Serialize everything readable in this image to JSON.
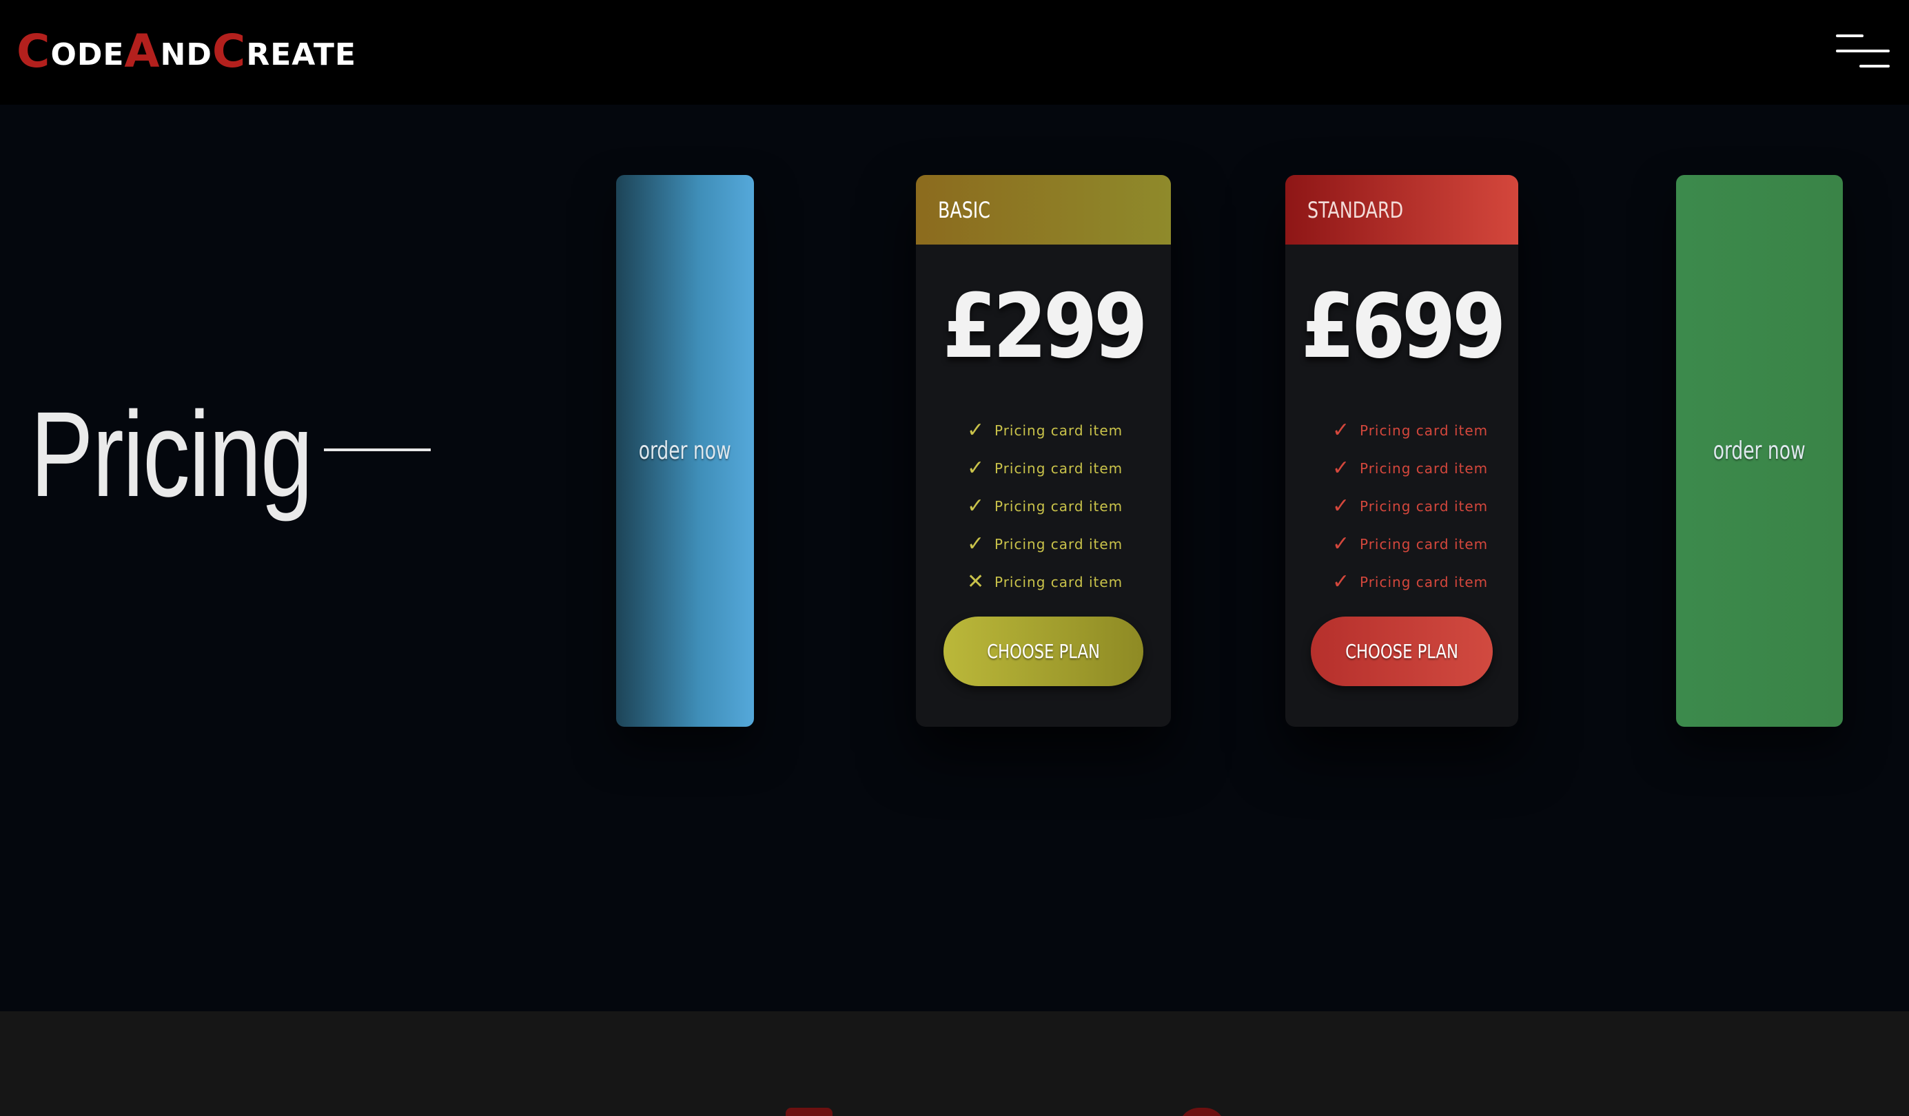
{
  "header": {
    "logo": [
      {
        "text": "C",
        "style": "cap"
      },
      {
        "text": "ODE",
        "style": "low"
      },
      {
        "text": "A",
        "style": "cap"
      },
      {
        "text": "ND",
        "style": "low"
      },
      {
        "text": "C",
        "style": "cap"
      },
      {
        "text": "REATE",
        "style": "low"
      }
    ],
    "menu_icon": "hamburger-menu-icon"
  },
  "hero": {
    "title": "Pricing"
  },
  "side_cards": {
    "left": {
      "label": "order now",
      "color": "#3f8eb8"
    },
    "right": {
      "label": "order now",
      "color": "#3c8a4c"
    }
  },
  "plans": [
    {
      "name": "BASIC",
      "price": "£299",
      "accent": "#c9c24a",
      "items": [
        {
          "label": "Pricing card item",
          "icon": "check-icon",
          "glyph": "✓"
        },
        {
          "label": "Pricing card item",
          "icon": "check-icon",
          "glyph": "✓"
        },
        {
          "label": "Pricing card item",
          "icon": "check-icon",
          "glyph": "✓"
        },
        {
          "label": "Pricing card item",
          "icon": "check-icon",
          "glyph": "✓"
        },
        {
          "label": "Pricing card item",
          "icon": "cross-icon",
          "glyph": "✕"
        }
      ],
      "button": "CHOOSE PLAN"
    },
    {
      "name": "STANDARD",
      "price": "£699",
      "accent": "#d4473c",
      "items": [
        {
          "label": "Pricing card item",
          "icon": "check-icon",
          "glyph": "✓"
        },
        {
          "label": "Pricing card item",
          "icon": "check-icon",
          "glyph": "✓"
        },
        {
          "label": "Pricing card item",
          "icon": "check-icon",
          "glyph": "✓"
        },
        {
          "label": "Pricing card item",
          "icon": "check-icon",
          "glyph": "✓"
        },
        {
          "label": "Pricing card item",
          "icon": "check-icon",
          "glyph": "✓"
        }
      ],
      "button": "CHOOSE PLAN"
    }
  ]
}
